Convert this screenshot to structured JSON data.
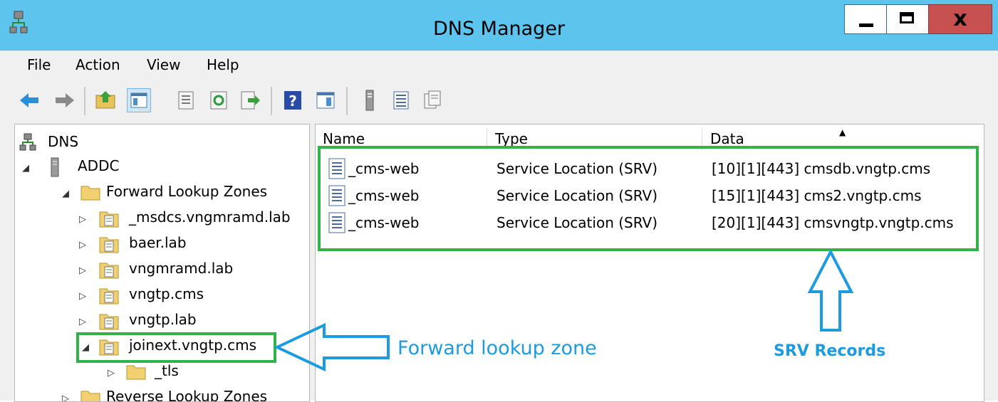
{
  "window": {
    "title": "DNS Manager",
    "close_glyph": "x",
    "accent_color": "#5dc4ee"
  },
  "menu": [
    "File",
    "Action",
    "View",
    "Help"
  ],
  "toolbar_icons": [
    "back-icon",
    "forward-icon",
    "up-folder-icon",
    "show-hide-tree-icon",
    "properties-icon",
    "refresh-icon",
    "export-list-icon",
    "help-icon",
    "action-pane-icon",
    "server-icon",
    "records-icon",
    "copy-icon"
  ],
  "tree": {
    "root": "DNS",
    "server": "ADDC",
    "forward_zones": "Forward Lookup Zones",
    "zones": [
      "_msdcs.vngmramd.lab",
      "baer.lab",
      "vngmramd.lab",
      "vngtp.cms",
      "vngtp.lab"
    ],
    "selected_zone": "joinext.vngtp.cms",
    "subfolder": "_tls",
    "reverse_zones": "Reverse Lookup Zones"
  },
  "list": {
    "columns": [
      "Name",
      "Type",
      "Data"
    ],
    "rows": [
      {
        "name": "_cms-web",
        "type": "Service Location (SRV)",
        "data": "[10][1][443] cmsdb.vngtp.cms"
      },
      {
        "name": "_cms-web",
        "type": "Service Location (SRV)",
        "data": "[15][1][443] cms2.vngtp.cms"
      },
      {
        "name": "_cms-web",
        "type": "Service Location (SRV)",
        "data": "[20][1][443] cmsvngtp.vngtp.cms"
      }
    ]
  },
  "annotations": {
    "forward_label": "Forward lookup zone",
    "srv_label": "SRV Records",
    "highlight_color": "#2fb34a",
    "arrow_color": "#1c9be0"
  }
}
